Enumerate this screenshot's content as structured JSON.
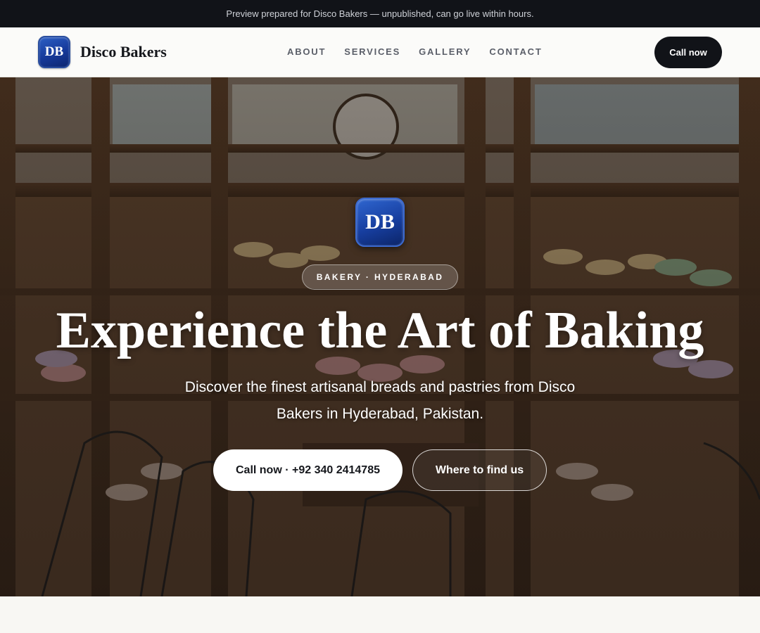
{
  "banner": {
    "text": "Preview prepared for Disco Bakers — unpublished, can go live within hours."
  },
  "brand": {
    "initials": "DB",
    "name": "Disco Bakers"
  },
  "nav": {
    "links": [
      "ABOUT",
      "SERVICES",
      "GALLERY",
      "CONTACT"
    ],
    "cta_label": "Call now"
  },
  "hero": {
    "logo_initials": "DB",
    "tag": "BAKERY · HYDERABAD",
    "title": "Experience the Art of Baking",
    "subtitle": "Discover the finest artisanal breads and pastries from Disco Bakers in Hyderabad, Pakistan.",
    "primary_cta": "Call now · +92 340 2414785",
    "secondary_cta": "Where to find us"
  },
  "colors": {
    "banner_bg": "#111318",
    "accent_blue": "#16399a",
    "cta_dark": "#111318",
    "page_bg": "#f8f7f3"
  }
}
